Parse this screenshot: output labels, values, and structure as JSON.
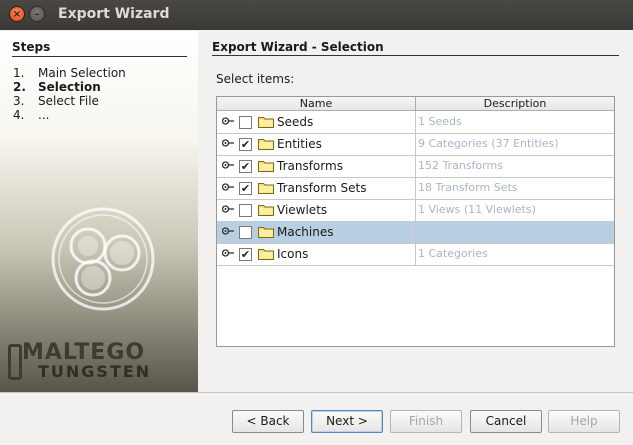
{
  "window": {
    "title": "Export Wizard"
  },
  "steps": {
    "heading": "Steps",
    "items": [
      {
        "num": "1.",
        "label": "Main Selection"
      },
      {
        "num": "2.",
        "label": "Selection"
      },
      {
        "num": "3.",
        "label": "Select File"
      },
      {
        "num": "4.",
        "label": "..."
      }
    ]
  },
  "brand": {
    "line1": "MALTEGO",
    "line2": "TUNGSTEN"
  },
  "main": {
    "title": "Export Wizard - Selection",
    "select_label": "Select items:",
    "columns": [
      "Name",
      "Description"
    ],
    "rows": [
      {
        "name": "Seeds",
        "checked": false,
        "description": "1 Seeds"
      },
      {
        "name": "Entities",
        "checked": true,
        "description": "9 Categories (37 Entities)"
      },
      {
        "name": "Transforms",
        "checked": true,
        "description": "152 Transforms"
      },
      {
        "name": "Transform Sets",
        "checked": true,
        "description": "18 Transform Sets"
      },
      {
        "name": "Viewlets",
        "checked": false,
        "description": "1 Views (11 Viewlets)"
      },
      {
        "name": "Machines",
        "checked": false,
        "description": ""
      },
      {
        "name": "Icons",
        "checked": true,
        "description": "1 Categories"
      }
    ]
  },
  "buttons": {
    "back": "< Back",
    "next": "Next >",
    "finish": "Finish",
    "cancel": "Cancel",
    "help": "Help"
  },
  "colors": {
    "selected_row": "#b8cee2",
    "description_text": "#a9b6c2",
    "titlebar": "#3b3936"
  }
}
